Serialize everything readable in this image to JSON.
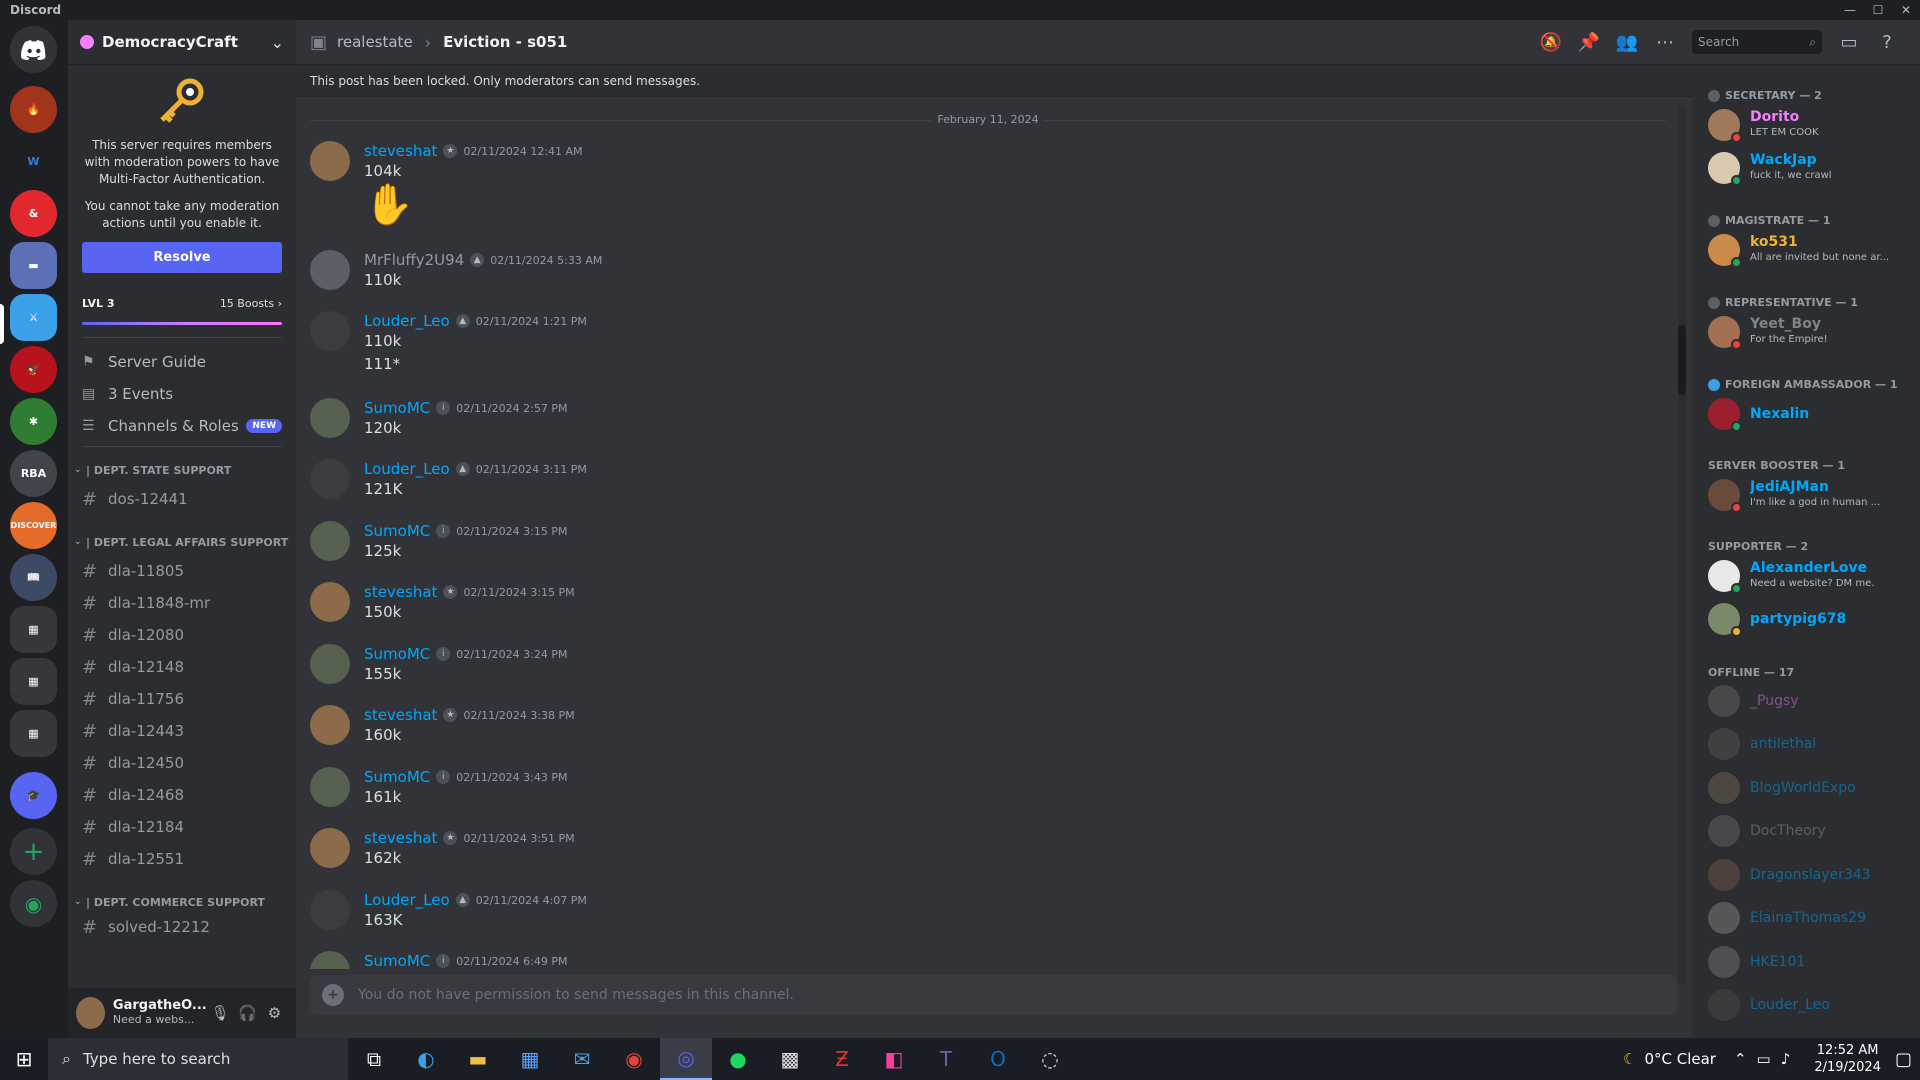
{
  "window": {
    "title": "Discord"
  },
  "server": {
    "name": "DemocracyCraft"
  },
  "mfa": {
    "line1": "This server requires members with moderation powers to have Multi-Factor Authentication.",
    "line2": "You cannot take any moderation actions until you enable it.",
    "button": "Resolve"
  },
  "boost": {
    "level": "LVL 3",
    "count": "15 Boosts"
  },
  "nav": [
    {
      "label": "Server Guide"
    },
    {
      "label": "3 Events"
    },
    {
      "label": "Channels & Roles",
      "badge": "NEW"
    }
  ],
  "categories": [
    {
      "name": "| DEPT. STATE SUPPORT",
      "channels": [
        "dos-12441"
      ]
    },
    {
      "name": "| DEPT. LEGAL AFFAIRS SUPPORT",
      "channels": [
        "dla-11805",
        "dla-11848-mr",
        "dla-12080",
        "dla-12148",
        "dla-11756",
        "dla-12443",
        "dla-12450",
        "dla-12468",
        "dla-12184",
        "dla-12551"
      ]
    },
    {
      "name": "| DEPT. COMMERCE SUPPORT",
      "channels": [
        "solved-12212"
      ]
    }
  ],
  "user": {
    "name": "GargatheO...",
    "status": "Need a webs..."
  },
  "header": {
    "forum": "realestate",
    "thread": "Eviction - s051"
  },
  "search": {
    "placeholder": "Search"
  },
  "locked_notice": "This post has been locked. Only moderators can send messages.",
  "date_divider": "February 11, 2024",
  "messages": [
    {
      "author": "steveshat",
      "time": "02/11/2024 12:41 AM",
      "text": "104k",
      "emoji": "✋"
    },
    {
      "author": "MrFluffy2U94",
      "time": "02/11/2024 5:33 AM",
      "text": "110k"
    },
    {
      "author": "Louder_Leo",
      "time": "02/11/2024 1:21 PM",
      "text": "110k",
      "text2": "111*"
    },
    {
      "author": "SumoMC",
      "time": "02/11/2024 2:57 PM",
      "text": "120k"
    },
    {
      "author": "Louder_Leo",
      "time": "02/11/2024 3:11 PM",
      "text": "121K"
    },
    {
      "author": "SumoMC",
      "time": "02/11/2024 3:15 PM",
      "text": "125k"
    },
    {
      "author": "steveshat",
      "time": "02/11/2024 3:15 PM",
      "text": "150k"
    },
    {
      "author": "SumoMC",
      "time": "02/11/2024 3:24 PM",
      "text": "155k"
    },
    {
      "author": "steveshat",
      "time": "02/11/2024 3:38 PM",
      "text": "160k"
    },
    {
      "author": "SumoMC",
      "time": "02/11/2024 3:43 PM",
      "text": "161k"
    },
    {
      "author": "steveshat",
      "time": "02/11/2024 3:51 PM",
      "text": "162k"
    },
    {
      "author": "Louder_Leo",
      "time": "02/11/2024 4:07 PM",
      "text": "163K"
    },
    {
      "author": "SumoMC",
      "time": "02/11/2024 6:49 PM",
      "text": ""
    }
  ],
  "composer": {
    "placeholder": "You do not have permission to send messages in this channel."
  },
  "member_groups": [
    {
      "label": "SECRETARY — 2",
      "members": [
        {
          "name": "Dorito",
          "status": "LET EM COOK",
          "color": "#f47fff"
        },
        {
          "name": "WackJap",
          "status": "fuck it, we crawl",
          "color": "#00a8fc"
        }
      ]
    },
    {
      "label": "MAGISTRATE — 1",
      "members": [
        {
          "name": "ko531",
          "status": "All are invited but none ar...",
          "color": "#f0b232"
        }
      ]
    },
    {
      "label": "REPRESENTATIVE — 1",
      "members": [
        {
          "name": "Yeet_Boy",
          "status": "For the Empire!",
          "color": "#80848e"
        }
      ]
    },
    {
      "label": "FOREIGN AMBASSADOR — 1",
      "members": [
        {
          "name": "Nexalin",
          "status": "",
          "color": "#00a8fc"
        }
      ]
    },
    {
      "label": "SERVER BOOSTER — 1",
      "members": [
        {
          "name": "JediAJMan",
          "status": "I'm like a god in human ...",
          "color": "#00a8fc"
        }
      ]
    },
    {
      "label": "SUPPORTER — 2",
      "members": [
        {
          "name": "AlexanderLove",
          "status": "Need a website? DM me.",
          "color": "#00a8fc"
        },
        {
          "name": "partypig678",
          "status": "",
          "color": "#00a8fc"
        }
      ]
    },
    {
      "label": "OFFLINE — 17",
      "members": [
        {
          "name": "_Pugsy",
          "color": "#f47fff"
        },
        {
          "name": "antilethal",
          "color": "#00a8fc"
        },
        {
          "name": "BlogWorldExpo",
          "color": "#00a8fc"
        },
        {
          "name": "DocTheory",
          "color": "#949ba4"
        },
        {
          "name": "Dragonslayer343",
          "color": "#00a8fc"
        },
        {
          "name": "ElainaThomas29",
          "color": "#00a8fc"
        },
        {
          "name": "HKE101",
          "color": "#00a8fc"
        },
        {
          "name": "Louder_Leo",
          "color": "#00a8fc"
        }
      ]
    }
  ],
  "taskbar": {
    "search_placeholder": "Type here to search",
    "weather": "0°C  Clear",
    "time": "12:52 AM",
    "date": "2/19/2024"
  }
}
